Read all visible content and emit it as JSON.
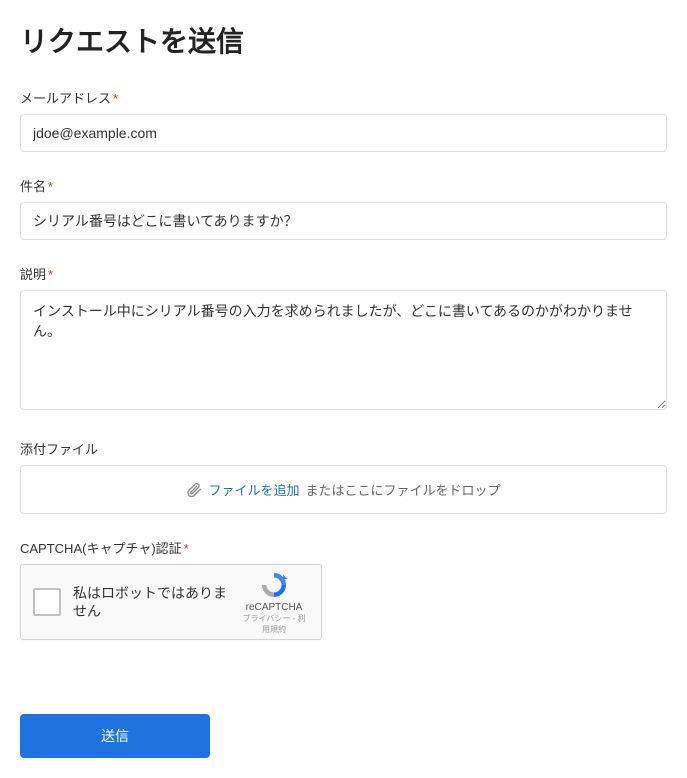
{
  "title": "リクエストを送信",
  "fields": {
    "email": {
      "label": "メールアドレス",
      "value": "jdoe@example.com"
    },
    "subject": {
      "label": "件名",
      "value": "シリアル番号はどこに書いてありますか？"
    },
    "description": {
      "label": "説明",
      "value": "インストール中にシリアル番号の入力を求められましたが、どこに書いてあるのかがわかりません。"
    },
    "attachments": {
      "label": "添付ファイル",
      "link_text": "ファイルを追加",
      "suffix_text": "またはここにファイルをドロップ"
    },
    "captcha": {
      "label": "CAPTCHA(キャプチャ)認証",
      "checkbox_label": "私はロボットではありません",
      "brand": "reCAPTCHA",
      "terms": "プライバシー - 利用規約"
    }
  },
  "required_marker": "*",
  "submit_label": "送信"
}
